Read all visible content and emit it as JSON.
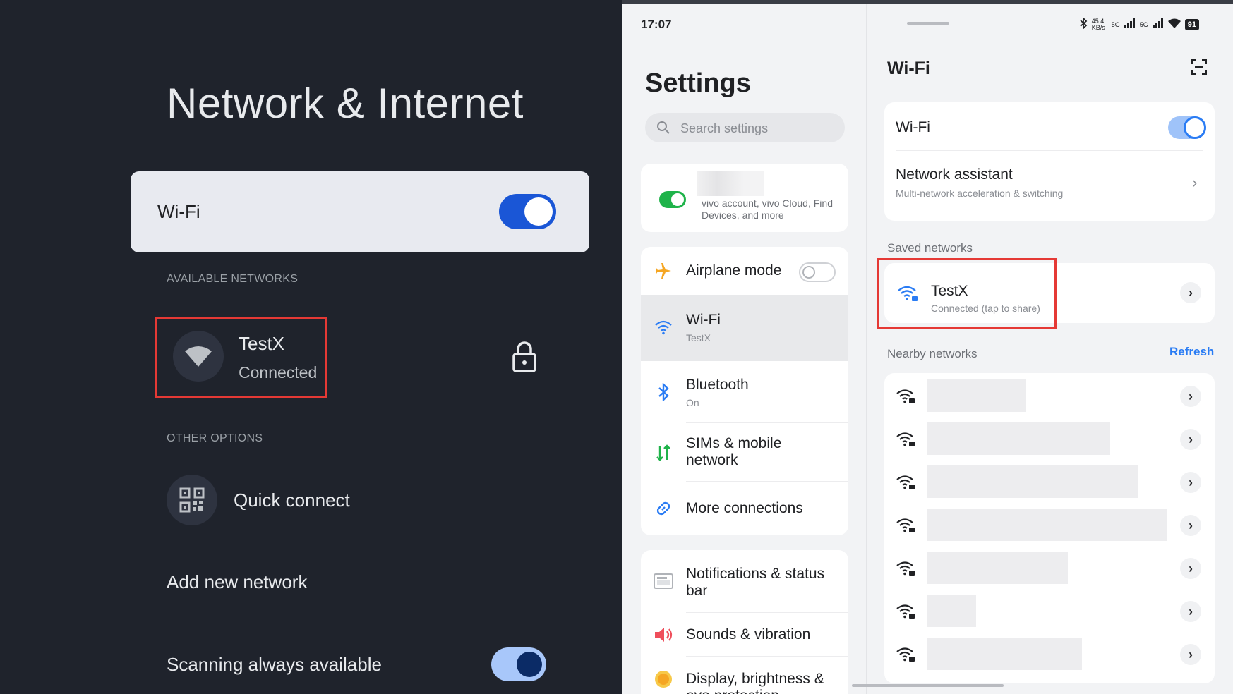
{
  "tv": {
    "title": "Network & Internet",
    "wifi_label": "Wi-Fi",
    "wifi_on": true,
    "available_networks_header": "AVAILABLE NETWORKS",
    "network": {
      "name": "TestX",
      "status": "Connected"
    },
    "other_options_header": "OTHER OPTIONS",
    "quick_connect_label": "Quick connect",
    "add_network_label": "Add new network",
    "scanning_label": "Scanning always available",
    "scanning_on": true
  },
  "phone": {
    "time": "17:07",
    "status": {
      "speed": "45.4 KB/s",
      "signal1": "5G",
      "signal2": "5G",
      "battery": "91"
    },
    "settings": {
      "title": "Settings",
      "search_placeholder": "Search settings",
      "account_text": "vivo account, vivo Cloud, Find Devices, and more",
      "items": [
        {
          "title": "Airplane mode",
          "subtitle": "",
          "icon": "airplane-icon"
        },
        {
          "title": "Wi-Fi",
          "subtitle": "TestX",
          "icon": "wifi-icon"
        },
        {
          "title": "Bluetooth",
          "subtitle": "On",
          "icon": "bluetooth-icon"
        },
        {
          "title": "SIMs & mobile network",
          "subtitle": "",
          "icon": "sim-data-icon"
        },
        {
          "title": "More connections",
          "subtitle": "",
          "icon": "link-icon"
        },
        {
          "title": "Notifications & status bar",
          "subtitle": "",
          "icon": "notification-icon"
        },
        {
          "title": "Sounds & vibration",
          "subtitle": "",
          "icon": "speaker-icon"
        },
        {
          "title": "Display, brightness & eye protection",
          "subtitle": "",
          "icon": "display-icon"
        }
      ]
    },
    "wifi": {
      "title": "Wi-Fi",
      "toggle_label": "Wi-Fi",
      "toggle_on": true,
      "assistant_title": "Network assistant",
      "assistant_sub": "Multi-network acceleration & switching",
      "saved_header": "Saved networks",
      "saved_network": {
        "name": "TestX",
        "status": "Connected (tap to share)"
      },
      "nearby_header": "Nearby networks",
      "refresh_label": "Refresh",
      "nearby_count": 7
    }
  },
  "colors": {
    "tv_bg": "#1f232c",
    "tv_accent": "#1a56d6",
    "highlight": "#e53935",
    "phone_accent": "#2a7cf4",
    "toggle_green": "#1fb34a"
  }
}
